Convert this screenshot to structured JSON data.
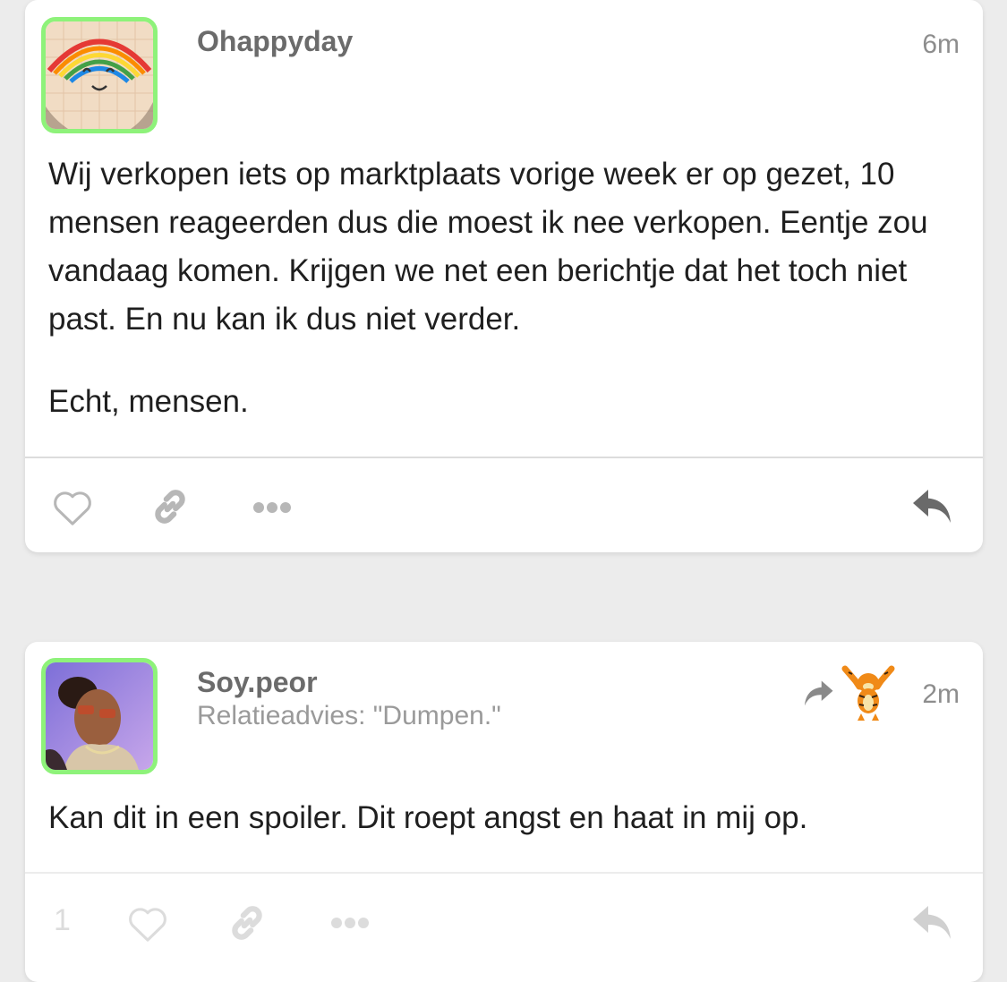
{
  "posts": [
    {
      "username": "Ohappyday",
      "time": "6m",
      "avatar_icon": "rainbow-smiley-avatar",
      "body": [
        "Wij verkopen iets op marktplaats vorige week er op gezet, 10 mensen reageerden dus die moest ik nee verkopen. Eentje zou vandaag komen. Krijgen we net een berichtje dat het toch niet past. En nu kan ik dus niet verder.",
        "Echt, mensen."
      ],
      "actions": [
        "heart-icon",
        "link-icon",
        "more-icon",
        "reply-icon"
      ]
    },
    {
      "username": "Soy.peor",
      "subtitle": "Relatieadvies: \"Dumpen.\"",
      "time": "2m",
      "avatar_icon": "person-sunglasses-avatar",
      "repost_icons": [
        "repost-arrow-icon",
        "tigger-avatar"
      ],
      "body": [
        "Kan dit in een spoiler. Dit roept angst en haat in mij op."
      ],
      "like_count": "1",
      "actions": [
        "heart-icon",
        "link-icon",
        "more-icon",
        "reply-icon"
      ]
    }
  ],
  "colors": {
    "background": "#ececec",
    "avatar_border": "#8ef27a",
    "icon_active": "#b7b7b7",
    "icon_faded": "#dcdcdc"
  }
}
